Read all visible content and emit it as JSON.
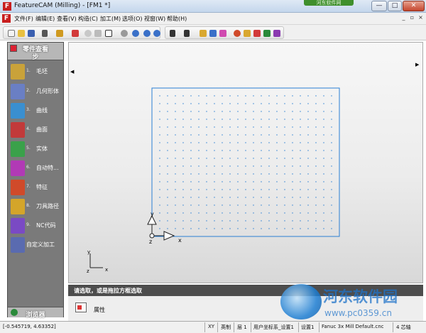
{
  "window": {
    "title": "FeatureCAM (Milling) - [FM1 *]",
    "badge": "河东软件网",
    "min_glyph": "—",
    "max_glyph": "□",
    "close_glyph": "✕",
    "logo_glyph": "F"
  },
  "menu": {
    "items": [
      "文件(F)",
      "编辑(E)",
      "查看(V)",
      "构造(C)",
      "加工(M)",
      "选项(O)",
      "视窗(W)",
      "帮助(H)"
    ],
    "mdi_buttons": [
      "_",
      "▫",
      "×"
    ]
  },
  "toolbar": {
    "icons": [
      "new-file-icon",
      "open-folder-icon",
      "save-icon",
      "move-icon",
      "feature-icon",
      "eraser-icon",
      "circle-icon",
      "cross-icon",
      "pointer-icon",
      "help-icon",
      "info-icon",
      "pan-icon",
      "zoom-icon",
      "curve-icon",
      "shape-icon",
      "cube-icon",
      "settings-icon",
      "tool-icon",
      "chip-icon",
      "gear-icon"
    ]
  },
  "panel": {
    "title": "零件查看",
    "subtitle": "步",
    "footer": "浏览器",
    "steps": [
      {
        "num": "1.",
        "label": "毛坯",
        "icon": "stock-icon",
        "color": "#c9a23a"
      },
      {
        "num": "2.",
        "label": "几何形体",
        "icon": "geometry-icon",
        "color": "#6a7fc4"
      },
      {
        "num": "3.",
        "label": "曲线",
        "icon": "curve-icon",
        "color": "#3a8fd0"
      },
      {
        "num": "4.",
        "label": "曲面",
        "icon": "surface-icon",
        "color": "#c23a3a"
      },
      {
        "num": "5.",
        "label": "实体",
        "icon": "solid-icon",
        "color": "#3aa14a"
      },
      {
        "num": "6.",
        "label": "自动特...",
        "icon": "auto-feature-icon",
        "color": "#b13ab5"
      },
      {
        "num": "7.",
        "label": "特征",
        "icon": "feature-icon",
        "color": "#d04a2a"
      },
      {
        "num": "8.",
        "label": "刀具路径",
        "icon": "toolpath-icon",
        "color": "#d4a52a"
      },
      {
        "num": "9.",
        "label": "NC代码",
        "icon": "nc-code-icon",
        "color": "#7a4ac4"
      },
      {
        "num": "",
        "label": "自定义加工",
        "icon": "custom-machining-icon",
        "color": "#5a6bb0"
      }
    ]
  },
  "viewport": {
    "scroll_left": "◀",
    "scroll_right": "▶",
    "axis_x": "x",
    "axis_y": "y",
    "axis_z": "z",
    "small_axis_x": "x",
    "small_axis_y": "y",
    "small_axis_z": "z",
    "grid_color": "#2a7fd4"
  },
  "prompt": {
    "text": "请选取，或是拖拉方框选取"
  },
  "properties": {
    "label": "属性"
  },
  "watermark": {
    "text": "河东软件园",
    "url": "www.pc0359.cn"
  },
  "status": {
    "coords": "[-0.545719, 4.63352]",
    "plane": "XY",
    "units": "英制",
    "layer": "层 1",
    "ucs": "用户坐标系_设置1",
    "setup": "设置1",
    "post": "Fanuc 3x Mill Default.cnc",
    "axes": "4 芯轴"
  }
}
